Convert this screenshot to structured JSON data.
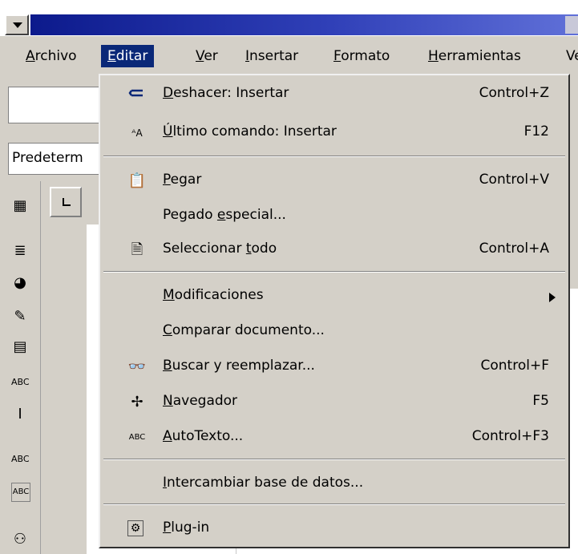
{
  "menubar": {
    "items": [
      "Archivo",
      "Editar",
      "Ver",
      "Insertar",
      "Formato",
      "Herramientas",
      "Ve"
    ]
  },
  "toolbar": {
    "style_value": "Predeterm"
  },
  "edit_menu": {
    "groups": [
      [
        {
          "icon": "undo-icon",
          "label": "Deshacer: Insertar",
          "shortcut": "Control+Z"
        },
        {
          "icon": "repeat-icon",
          "label": "Último comando: Insertar",
          "shortcut": "F12"
        }
      ],
      [
        {
          "icon": "paste-icon",
          "label": "Pegar",
          "shortcut": "Control+V"
        },
        {
          "icon": "",
          "label": "Pegado especial...",
          "shortcut": ""
        },
        {
          "icon": "select-all-icon",
          "label": "Seleccionar todo",
          "shortcut": "Control+A"
        }
      ],
      [
        {
          "icon": "",
          "label": "Modificaciones",
          "shortcut": "",
          "submenu": true
        },
        {
          "icon": "",
          "label": "Comparar documento...",
          "shortcut": ""
        },
        {
          "icon": "binoculars-icon",
          "label": "Buscar y reemplazar...",
          "shortcut": "Control+F"
        },
        {
          "icon": "navigator-icon",
          "label": "Navegador",
          "shortcut": "F5"
        },
        {
          "icon": "autotext-icon",
          "label": "AutoTexto...",
          "shortcut": "Control+F3"
        }
      ],
      [
        {
          "icon": "",
          "label": "Intercambiar base de datos...",
          "shortcut": ""
        }
      ],
      [
        {
          "icon": "plugin-icon",
          "label": "Plug-in",
          "shortcut": ""
        }
      ]
    ]
  }
}
